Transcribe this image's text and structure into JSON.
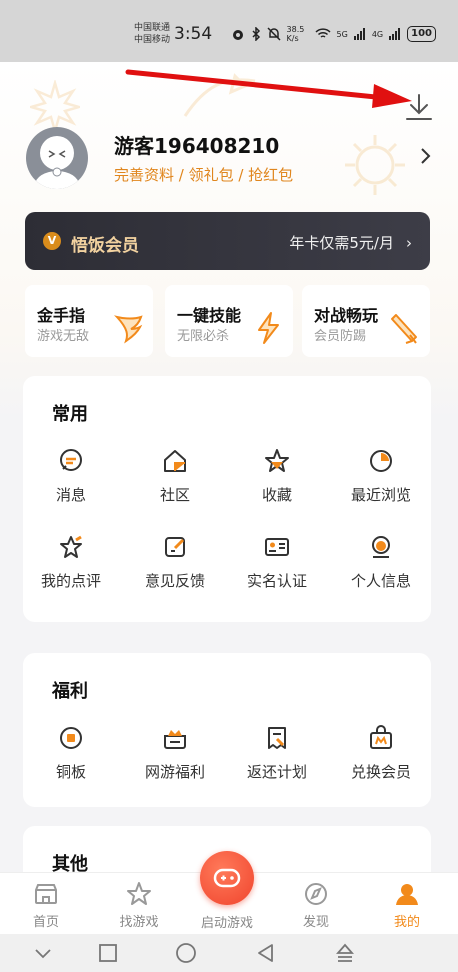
{
  "status_bar": {
    "carrier_1": "中国联通",
    "carrier_2": "中国移动",
    "time": "3:54",
    "network_speed": "38.5 K/s",
    "signal_1": "5G",
    "signal_2": "4G",
    "battery": "100"
  },
  "profile": {
    "username": "游客196408210",
    "links": "完善资料 / 领礼包 / 抢红包"
  },
  "vip": {
    "title": "悟饭会员",
    "offer": "年卡仅需5元/月"
  },
  "perks": [
    {
      "title": "金手指",
      "subtitle": "游戏无敌"
    },
    {
      "title": "一键技能",
      "subtitle": "无限必杀"
    },
    {
      "title": "对战畅玩",
      "subtitle": "会员防踢"
    }
  ],
  "common": {
    "title": "常用",
    "items": [
      {
        "label": "消息",
        "icon": "message-icon"
      },
      {
        "label": "社区",
        "icon": "community-icon"
      },
      {
        "label": "收藏",
        "icon": "star-icon"
      },
      {
        "label": "最近浏览",
        "icon": "recent-icon"
      },
      {
        "label": "我的点评",
        "icon": "review-icon"
      },
      {
        "label": "意见反馈",
        "icon": "feedback-icon"
      },
      {
        "label": "实名认证",
        "icon": "id-card-icon"
      },
      {
        "label": "个人信息",
        "icon": "person-icon"
      }
    ]
  },
  "welfare": {
    "title": "福利",
    "items": [
      {
        "label": "铜板",
        "icon": "coin-icon"
      },
      {
        "label": "网游福利",
        "icon": "crown-gift-icon"
      },
      {
        "label": "返还计划",
        "icon": "refund-icon"
      },
      {
        "label": "兑换会员",
        "icon": "vip-bag-icon"
      }
    ]
  },
  "other": {
    "title": "其他"
  },
  "tabs": {
    "home": "首页",
    "find": "找游戏",
    "launch": "启动游戏",
    "discover": "发现",
    "mine": "我的"
  },
  "colors": {
    "accent": "#f28a1b",
    "links": "#e0861e",
    "vip_bg": "#2d2d35",
    "vip_title": "#f2d2a0",
    "annotation_arrow": "#e01010"
  }
}
